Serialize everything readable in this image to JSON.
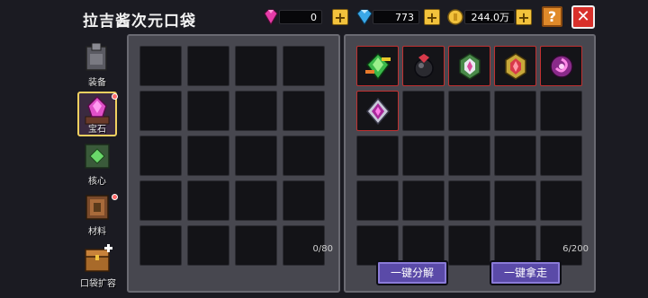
{
  "header": {
    "title": "拉吉酱次元口袋",
    "currencies": [
      {
        "name": "pink-gem",
        "value": "0",
        "color": "#e63ca8"
      },
      {
        "name": "blue-diamond",
        "value": "773",
        "color": "#3aa8e8"
      },
      {
        "name": "gold-coin",
        "value": "244.0万",
        "color": "#f2c23c"
      }
    ],
    "plus_label": "+",
    "help_label": "?",
    "close_label": "✕"
  },
  "sidebar": {
    "items": [
      {
        "label": "装备",
        "icon": "armor-icon",
        "active": false,
        "badge": false
      },
      {
        "label": "宝石",
        "icon": "gem-icon",
        "active": true,
        "badge": true
      },
      {
        "label": "核心",
        "icon": "core-icon",
        "active": false,
        "badge": false
      },
      {
        "label": "材料",
        "icon": "material-icon",
        "active": false,
        "badge": true
      },
      {
        "label": "口袋扩容",
        "icon": "chest-expand-icon",
        "active": false,
        "badge": false
      }
    ]
  },
  "left_panel": {
    "count": "0/80"
  },
  "right_panel": {
    "count": "6/200",
    "items": [
      {
        "icon": "green-gem-icon"
      },
      {
        "icon": "dark-bomb-gem-icon"
      },
      {
        "icon": "white-crystal-gem-icon"
      },
      {
        "icon": "red-crystal-gem-icon"
      },
      {
        "icon": "purple-swirl-gem-icon"
      },
      {
        "icon": "purple-diamond-gem-icon"
      }
    ]
  },
  "actions": {
    "decompose_label": "一键分解",
    "take_all_label": "一键拿走"
  },
  "colors": {
    "accent_button": "#5a4aa8",
    "item_border": "#c03030",
    "panel_bg": "#47474f"
  }
}
